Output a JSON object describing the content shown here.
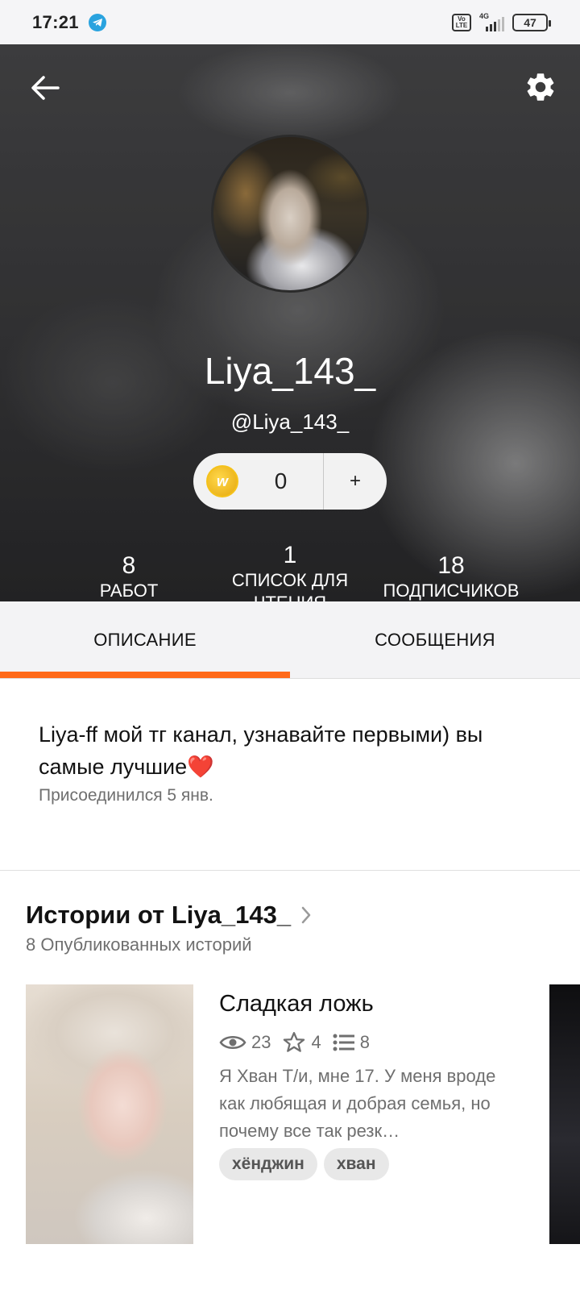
{
  "status": {
    "time": "17:21",
    "battery": "47",
    "network": "4G",
    "volte": "Vo LTE"
  },
  "profile": {
    "display_name": "Liya_143_",
    "handle": "@Liya_143_",
    "coins": "0",
    "coin_symbol": "w",
    "add_label": "+",
    "stats": {
      "works": {
        "value": "8",
        "label": "РАБОТ"
      },
      "reading_list": {
        "value": "1",
        "label_line1": "СПИСОК ДЛЯ",
        "label_line2": "ЧТЕНИЯ"
      },
      "followers": {
        "value": "18",
        "label": "ПОДПИСЧИКОВ"
      }
    }
  },
  "tabs": [
    {
      "label": "ОПИСАНИЕ",
      "active": true
    },
    {
      "label": "СООБЩЕНИЯ",
      "active": false
    }
  ],
  "about": {
    "bio": "Liya-ff мой тг канал, узнавайте первыми) вы самые лучшие❤️",
    "joined": "Присоединился 5 янв."
  },
  "stories": {
    "title": "Истории от Liya_143_",
    "subtitle": "8 Опубликованных историй",
    "items": [
      {
        "title": "Сладкая ложь",
        "views": "23",
        "votes": "4",
        "parts": "8",
        "description": "Я Хван Т/и, мне 17. У меня вроде как любящая и добрая семья, но почему все так резк…",
        "tags": [
          "хёнджин",
          "хван"
        ]
      }
    ]
  },
  "colors": {
    "accent": "#ff6a1a",
    "tab_bg": "#f3f3f5",
    "muted_text": "#6f6f6f"
  }
}
